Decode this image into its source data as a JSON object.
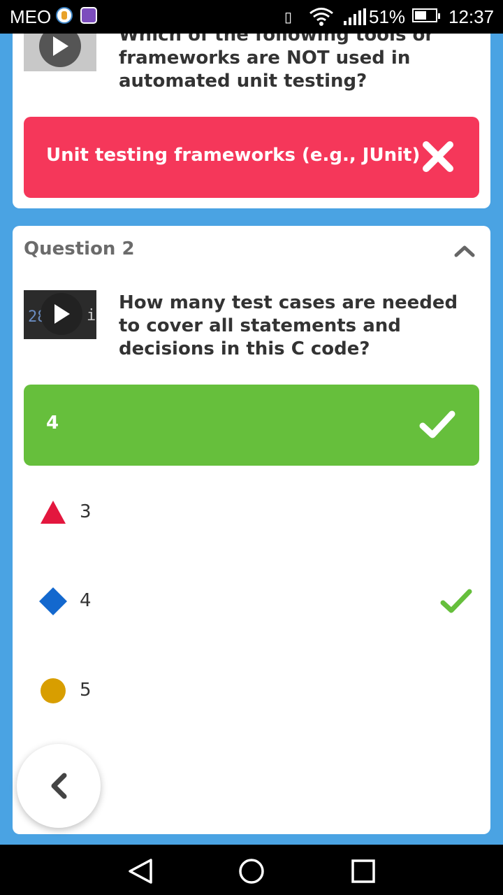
{
  "status_bar": {
    "carrier": "MEO",
    "battery_percent": "51%",
    "time": "12:37"
  },
  "question1": {
    "text": "Which of the following tools or frameworks are NOT used in automated unit testing?",
    "answer_label": "Unit testing frameworks (e.g., JUnit)",
    "answer_status": "incorrect",
    "answer_color": "#f5375a",
    "thumbnail_icon": "play-icon"
  },
  "question2": {
    "header": "Question 2",
    "text": "How many test cases are needed to cover all statements and decisions in this C code?",
    "thumbnail_code": [
      "28",
      "i"
    ],
    "thumbnail_icon": "play-icon",
    "selected_answer": "4",
    "selected_status": "correct",
    "selected_color": "#66bf3c",
    "options": [
      {
        "shape": "triangle",
        "color": "#e3173e",
        "label": "3",
        "correct": false
      },
      {
        "shape": "diamond",
        "color": "#1368ce",
        "label": "4",
        "correct": true
      },
      {
        "shape": "circle",
        "color": "#d89e00",
        "label": "5",
        "correct": false
      }
    ]
  },
  "fab_icon": "chevron-left-icon",
  "nav": [
    "back-icon",
    "home-icon",
    "recents-icon"
  ]
}
